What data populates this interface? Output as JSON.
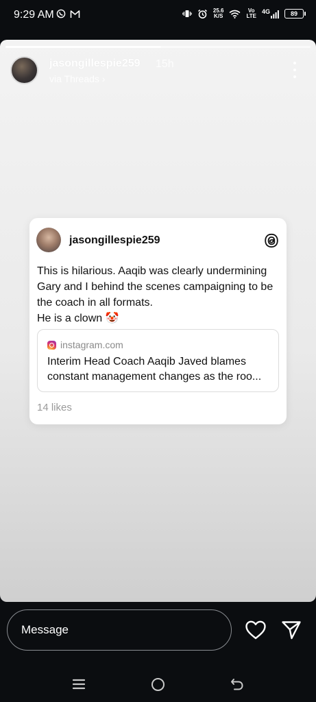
{
  "status_bar": {
    "time": "9:29 AM",
    "left_icons": [
      "whatsapp-icon",
      "gmail-icon"
    ],
    "network_speed_value": "25.6",
    "network_speed_unit": "K/S",
    "volte_top": "Vo",
    "volte_bottom": "LTE",
    "network_type": "4G",
    "battery": "89"
  },
  "story": {
    "progress": 0.51,
    "username": "jasongillespie259",
    "time_ago": "15h",
    "via": "via Threads ›"
  },
  "card": {
    "username": "jasongillespie259",
    "text_line1": "This is hilarious. Aaqib was clearly undermining Gary and I behind the scenes campaigning to be the coach in all formats.",
    "text_line2": "He is a clown 🤡",
    "link_domain": "instagram.com",
    "link_title": "Interim Head Coach Aaqib Javed blames constant management changes as the roo...",
    "likes": "14 likes"
  },
  "reply": {
    "placeholder": "Message"
  },
  "colors": {
    "background": "#0b0d10",
    "story_bg": "#efefef",
    "card_bg": "#ffffff"
  }
}
